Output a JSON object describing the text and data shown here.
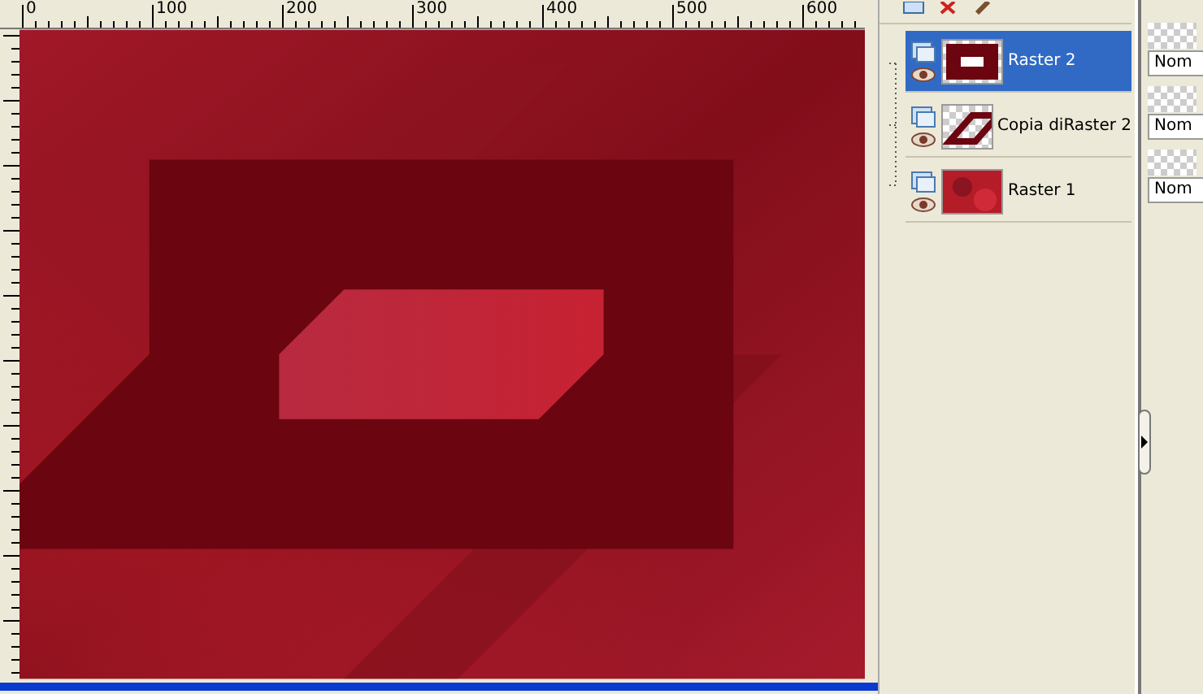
{
  "ruler": {
    "labels": [
      "0",
      "100",
      "200",
      "300",
      "400",
      "500",
      "600"
    ]
  },
  "layers": [
    {
      "name": "Raster 2",
      "selected": true,
      "kind": "frame"
    },
    {
      "name": "Copia diRaster 2",
      "selected": false,
      "kind": "diamond"
    },
    {
      "name": "Raster 1",
      "selected": false,
      "kind": "texture"
    }
  ],
  "blend_modes": [
    "Nom",
    "Nom",
    "Nom"
  ]
}
